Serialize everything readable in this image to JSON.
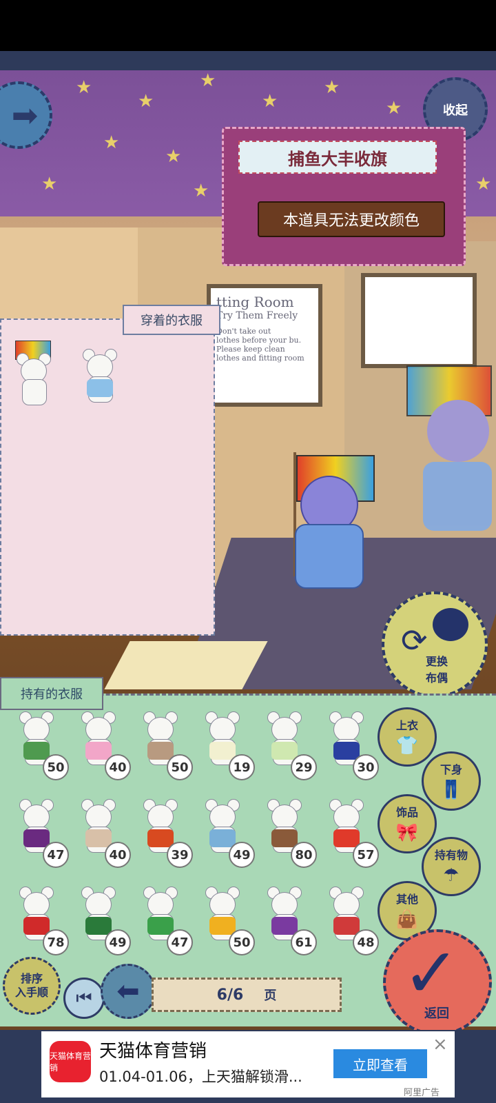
{
  "item_banner": {
    "title": "捕鱼大丰收旗",
    "message": "本道具无法更改颜色"
  },
  "buttons": {
    "collapse": "收起",
    "change_doll": "更换布偶",
    "back": "返回",
    "sort": "排序\n入手顺"
  },
  "worn_panel": {
    "title": "穿着的衣服"
  },
  "owned_panel": {
    "title": "持有的衣服"
  },
  "categories": [
    {
      "label": "上衣",
      "icon": "shirt-icon"
    },
    {
      "label": "下身",
      "icon": "pants-icon"
    },
    {
      "label": "饰品",
      "icon": "bowtie-icon"
    },
    {
      "label": "持有物",
      "icon": "umbrella-icon"
    },
    {
      "label": "其他",
      "icon": "bag-icon"
    }
  ],
  "fitting_room_poster": {
    "heading": "tting Room",
    "line1": "Try Them Freely",
    "line2": "Don't take out",
    "line3": "lothes before your bu.",
    "line4": "Please keep clean",
    "line5": "lothes and fitting room"
  },
  "owned_items": [
    {
      "count": "50",
      "color": "#4f9a4f"
    },
    {
      "count": "40",
      "color": "#f2a6c8"
    },
    {
      "count": "50",
      "color": "#b89a80"
    },
    {
      "count": "19",
      "color": "#f2f0d0"
    },
    {
      "count": "29",
      "color": "#cfe8b0"
    },
    {
      "count": "30",
      "color": "#2a3fa0"
    },
    {
      "count": "47",
      "color": "#6a2a80"
    },
    {
      "count": "40",
      "color": "#d8c0a8"
    },
    {
      "count": "39",
      "color": "#d84a20"
    },
    {
      "count": "49",
      "color": "#7ab0d8"
    },
    {
      "count": "80",
      "color": "#8a5a3a"
    },
    {
      "count": "57",
      "color": "#e03a2a"
    },
    {
      "count": "78",
      "color": "#d02a2a"
    },
    {
      "count": "49",
      "color": "#2a7a3a"
    },
    {
      "count": "47",
      "color": "#3aa04a"
    },
    {
      "count": "50",
      "color": "#f0b020"
    },
    {
      "count": "61",
      "color": "#7a3aa0"
    },
    {
      "count": "48",
      "color": "#d03a3a"
    }
  ],
  "pager": {
    "current": "6/6",
    "unit": "页"
  },
  "ad": {
    "logo": "天猫体育营销",
    "title": "天猫体育营销",
    "subtitle": "01.04-01.06，上天猫解锁滑...",
    "cta": "立即查看",
    "close": "×",
    "mark": "阿里广告"
  }
}
